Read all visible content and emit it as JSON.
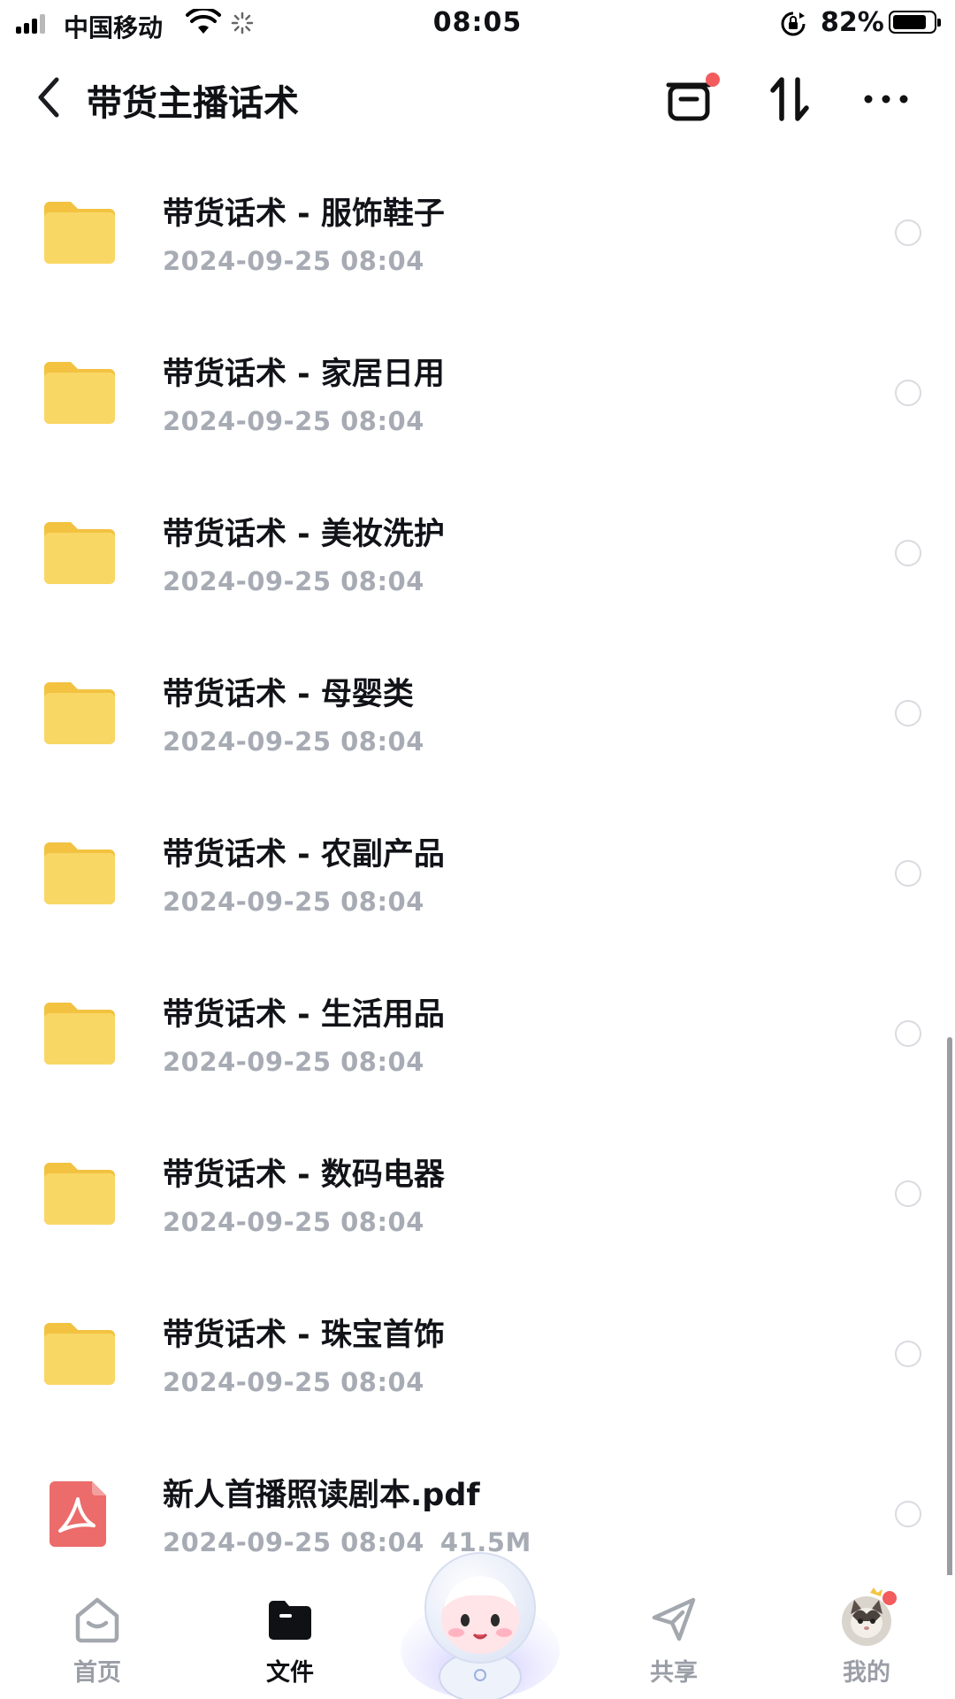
{
  "status_bar": {
    "carrier": "中国移动",
    "time": "08:05",
    "battery_percent": "82%",
    "battery_level": 0.82,
    "icons": [
      "signal-icon",
      "wifi-icon",
      "loading-icon",
      "rotation-lock-icon",
      "battery-icon"
    ]
  },
  "header": {
    "title": "带货主播话术",
    "icons": [
      "back-icon",
      "transfer-box-icon",
      "sort-icon",
      "more-icon"
    ]
  },
  "files": [
    {
      "name": "带货话术 - 服饰鞋子",
      "date": "2024-09-25 08:04",
      "size": "",
      "type": "folder"
    },
    {
      "name": "带货话术 - 家居日用",
      "date": "2024-09-25 08:04",
      "size": "",
      "type": "folder"
    },
    {
      "name": "带货话术 - 美妆洗护",
      "date": "2024-09-25 08:04",
      "size": "",
      "type": "folder"
    },
    {
      "name": "带货话术 - 母婴类",
      "date": "2024-09-25 08:04",
      "size": "",
      "type": "folder"
    },
    {
      "name": "带货话术 - 农副产品",
      "date": "2024-09-25 08:04",
      "size": "",
      "type": "folder"
    },
    {
      "name": "带货话术 - 生活用品",
      "date": "2024-09-25 08:04",
      "size": "",
      "type": "folder"
    },
    {
      "name": "带货话术 - 数码电器",
      "date": "2024-09-25 08:04",
      "size": "",
      "type": "folder"
    },
    {
      "name": "带货话术 - 珠宝首饰",
      "date": "2024-09-25 08:04",
      "size": "",
      "type": "folder"
    },
    {
      "name": "新人首播照读剧本.pdf",
      "date": "2024-09-25 08:04",
      "size": "41.5M",
      "type": "pdf"
    }
  ],
  "tab_bar": {
    "tabs": [
      {
        "label": "首页",
        "icon": "home-icon",
        "active": false
      },
      {
        "label": "文件",
        "icon": "folder-icon",
        "active": true
      },
      {
        "label": "",
        "icon": "mascot-icon",
        "active": false
      },
      {
        "label": "共享",
        "icon": "share-icon",
        "active": false
      },
      {
        "label": "我的",
        "icon": "avatar-icon",
        "active": false
      }
    ]
  },
  "colors": {
    "folder": "#f8d25a",
    "pdf": "#ec6b6b",
    "notification_dot": "#f25c5c",
    "meta_text": "#a7abb4"
  }
}
